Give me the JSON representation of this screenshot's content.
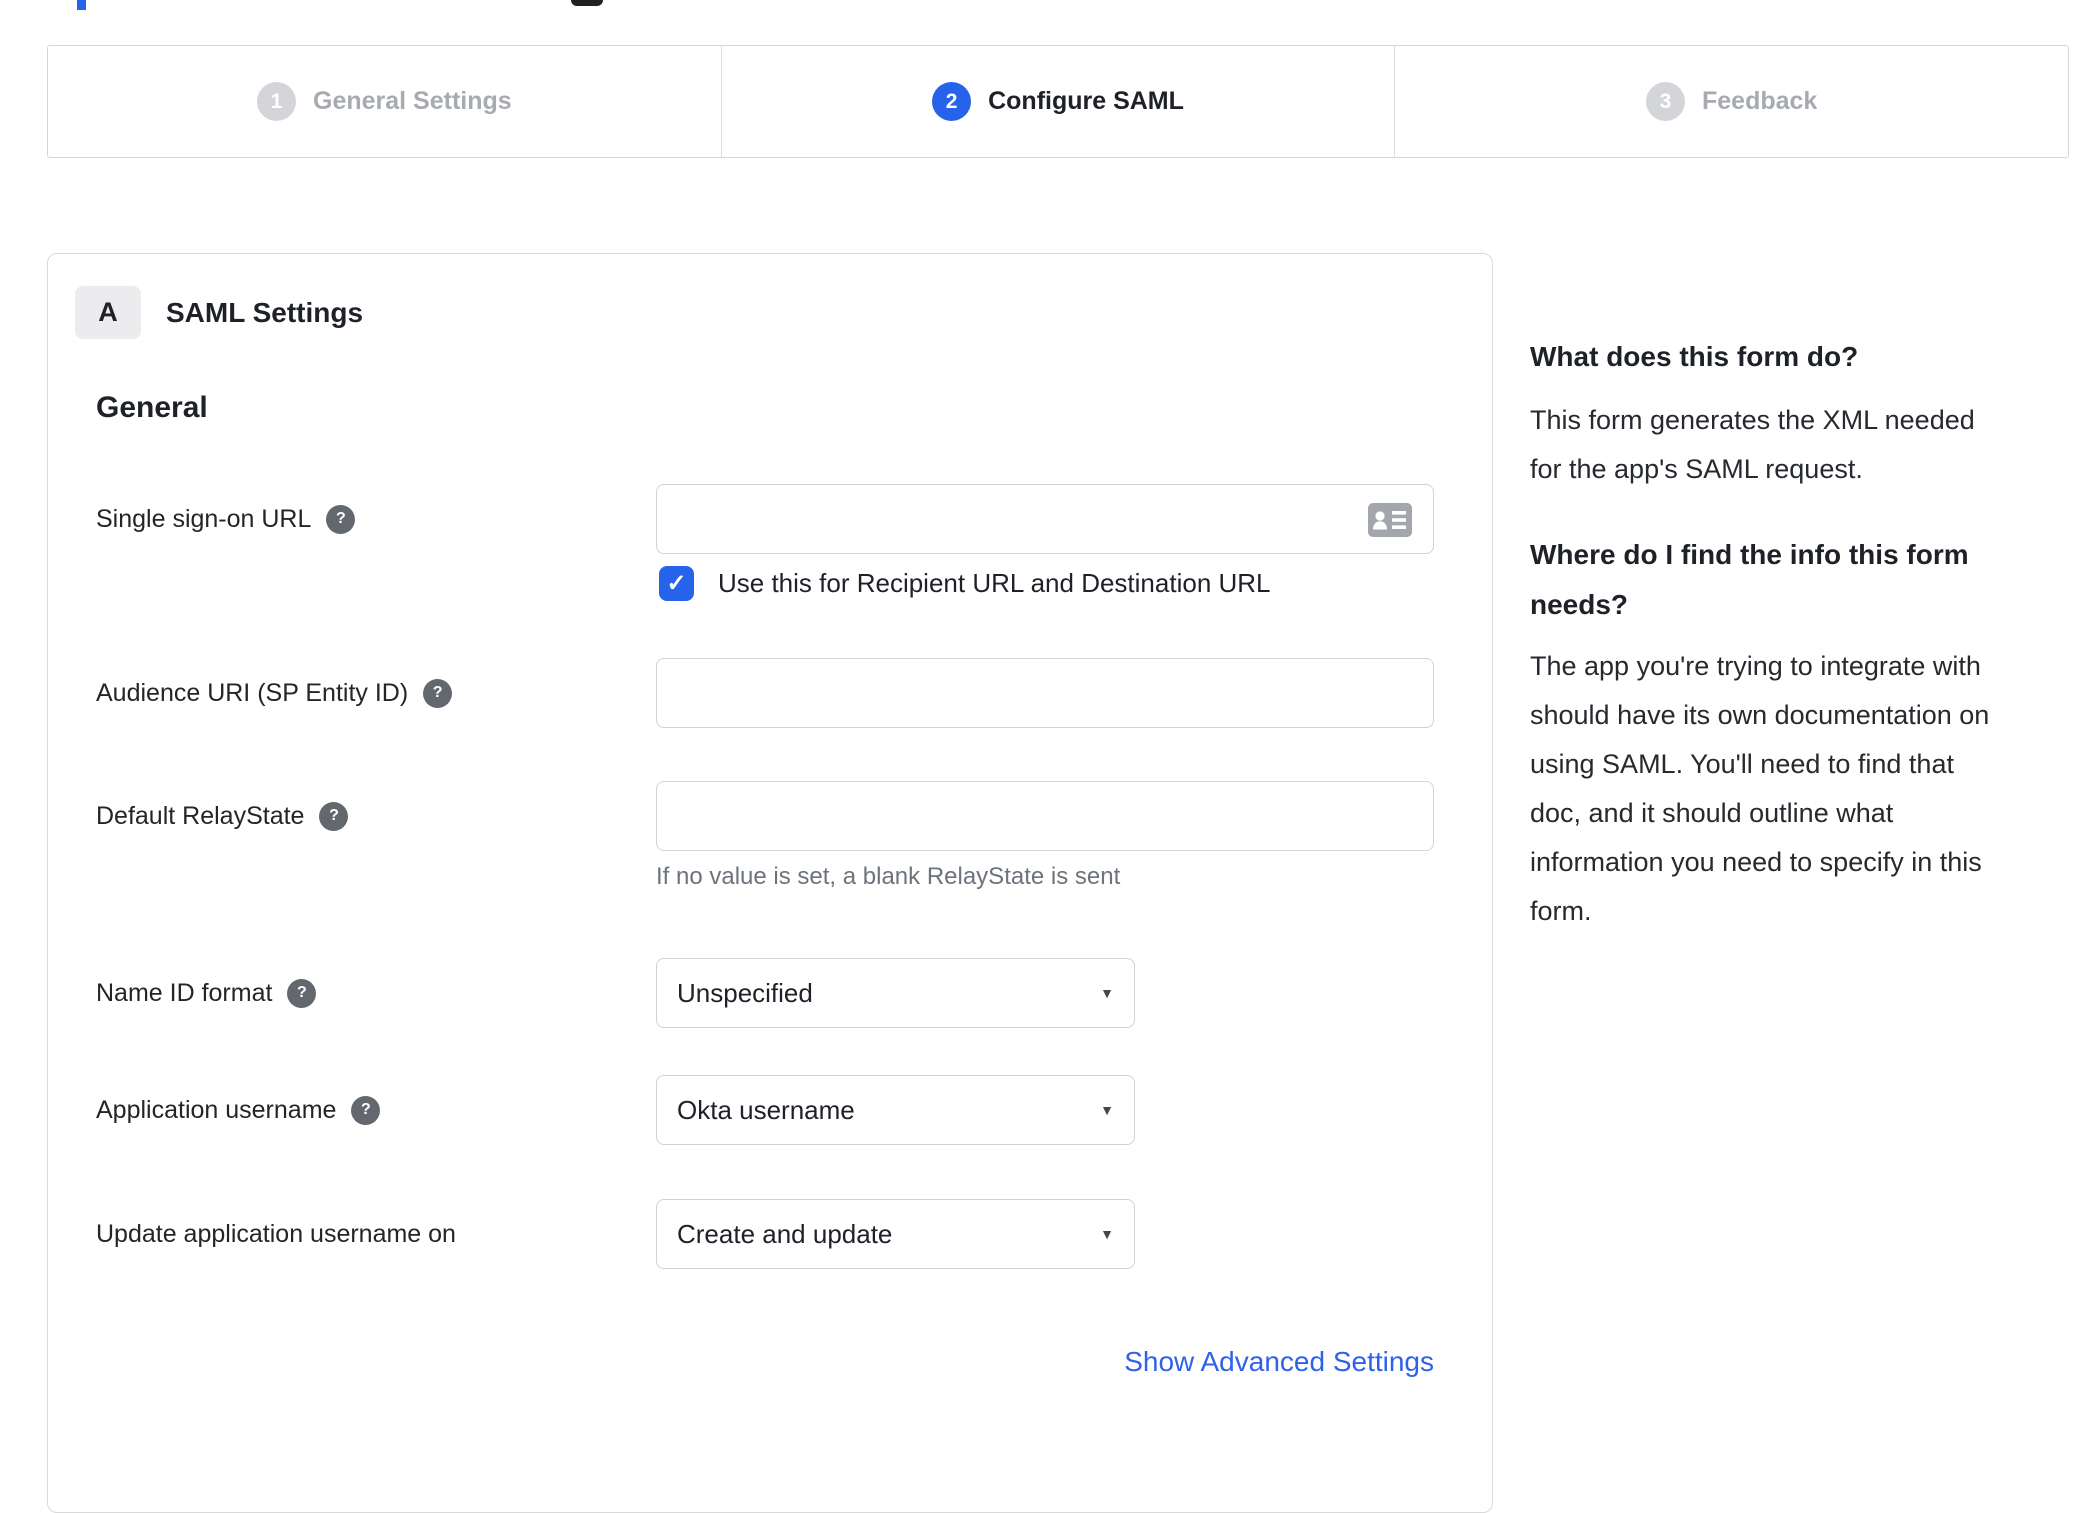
{
  "page": {
    "accent_blue": "#2563eb",
    "link_blue": "#2e62e9",
    "check_glyph": "✓",
    "caret_glyph": "▼",
    "help_glyph": "?"
  },
  "stepper": {
    "steps": [
      {
        "number": "1",
        "label": "General Settings",
        "state": "inactive"
      },
      {
        "number": "2",
        "label": "Configure SAML",
        "state": "active"
      },
      {
        "number": "3",
        "label": "Feedback",
        "state": "inactive"
      }
    ]
  },
  "panel": {
    "badge": "A",
    "title": "SAML Settings",
    "section": "General",
    "fields": {
      "sso": {
        "label": "Single sign-on URL",
        "value": "",
        "checkbox_label": "Use this for Recipient URL and Destination URL",
        "checked": true
      },
      "audience": {
        "label": "Audience URI (SP Entity ID)",
        "value": ""
      },
      "relay": {
        "label": "Default RelayState",
        "value": "",
        "hint": "If no value is set, a blank RelayState is sent"
      },
      "name_id": {
        "label": "Name ID format",
        "value": "Unspecified"
      },
      "app_username": {
        "label": "Application username",
        "value": "Okta username"
      },
      "update_on": {
        "label": "Update application username on",
        "value": "Create and update"
      }
    },
    "advanced_link": "Show Advanced Settings"
  },
  "sidebar": {
    "heading1": "What does this form do?",
    "para1": "This form generates the XML needed\nfor the app's SAML request.",
    "heading2": "Where do I find the info this form\nneeds?",
    "para2": "The app you're trying to integrate with\nshould have its own documentation on\nusing SAML. You'll need to find that\ndoc, and it should outline what\ninformation you need to specify in this\nform."
  }
}
